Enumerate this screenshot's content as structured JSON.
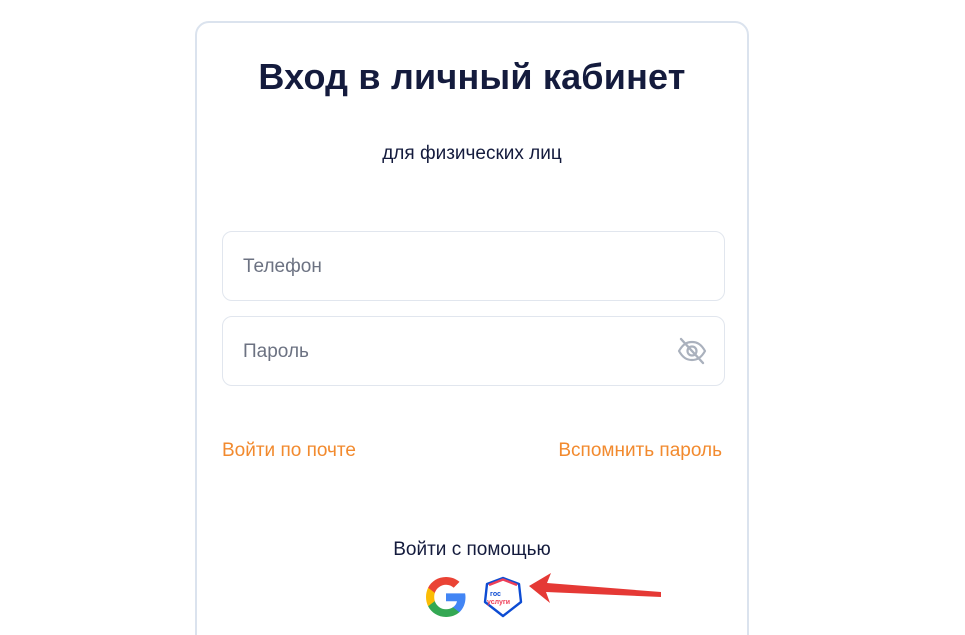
{
  "login": {
    "title": "Вход в личный кабинет",
    "subtitle": "для физических лиц",
    "phone_placeholder": "Телефон",
    "password_placeholder": "Пароль",
    "login_by_email": "Войти по почте",
    "forgot_password": "Вспомнить пароль",
    "social_caption": "Войти с помощью"
  },
  "social": {
    "google_icon": "google-icon",
    "gosuslugi_icon": "gosuslugi-icon",
    "gosuslugi_logo_line1": "гос",
    "gosuslugi_logo_line2": "услуги"
  },
  "colors": {
    "accent": "#f28a2e",
    "title": "#141b3d",
    "border": "#dbe3ee",
    "annotation_arrow": "#e53935",
    "gosuslugi_blue": "#0d4cd3",
    "gosuslugi_red": "#ee3f58"
  }
}
